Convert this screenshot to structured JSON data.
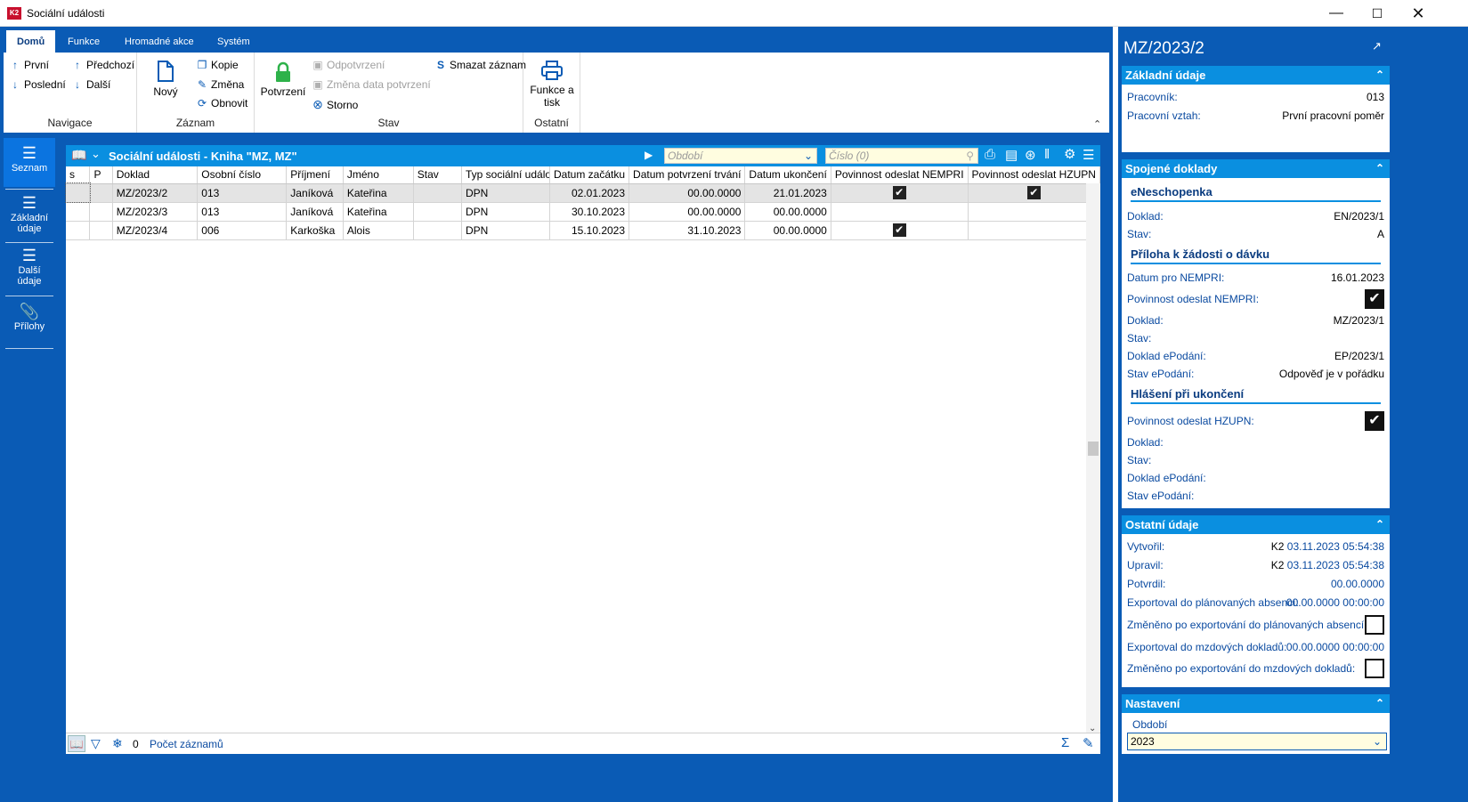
{
  "window": {
    "title": "Sociální události",
    "app_badge": "K2"
  },
  "ribbon": {
    "tabs": [
      "Domů",
      "Funkce",
      "Hromadné akce",
      "Systém"
    ],
    "nav": {
      "first": "První",
      "last": "Poslední",
      "prev": "Předchozí",
      "next": "Další",
      "group": "Navigace"
    },
    "record": {
      "new": "Nový",
      "copy": "Kopie",
      "change": "Změna",
      "refresh": "Obnovit",
      "group": "Záznam"
    },
    "state": {
      "confirm": "Potvrzení",
      "unconfirm": "Odpotvrzení",
      "change_date": "Změna data potvrzení",
      "storno": "Storno",
      "delete": "Smazat záznam",
      "group": "Stav"
    },
    "other": {
      "print_line1": "Funkce a",
      "print_line2": "tisk",
      "group": "Ostatní"
    }
  },
  "sidenav": {
    "items": [
      "Seznam",
      "Základní údaje",
      "Další údaje",
      "Přílohy"
    ]
  },
  "grid": {
    "title": "Sociální události - Kniha \"MZ, MZ\"",
    "period_placeholder": "Období",
    "number_placeholder": "Číslo (0)",
    "columns": [
      "s",
      "P",
      "Doklad",
      "Osobní číslo",
      "Příjmení",
      "Jméno",
      "Stav",
      "Typ sociální události",
      "Datum začátku",
      "Datum potvrzení trvání",
      "Datum ukončení",
      "Povinnost odeslat NEMPRI",
      "Povinnost odeslat HZUPN"
    ],
    "rows": [
      {
        "doklad": "MZ/2023/2",
        "osobni": "013",
        "prijmeni": "Janíková",
        "jmeno": "Kateřina",
        "stav": "",
        "typ": "DPN",
        "zacatek": "02.01.2023",
        "potvrzeni": "00.00.0000",
        "ukonceni": "21.01.2023",
        "nempri": true,
        "hzupn": true
      },
      {
        "doklad": "MZ/2023/3",
        "osobni": "013",
        "prijmeni": "Janíková",
        "jmeno": "Kateřina",
        "stav": "",
        "typ": "DPN",
        "zacatek": "30.10.2023",
        "potvrzeni": "00.00.0000",
        "ukonceni": "00.00.0000",
        "nempri": false,
        "hzupn": false
      },
      {
        "doklad": "MZ/2023/4",
        "osobni": "006",
        "prijmeni": "Karkoška",
        "jmeno": "Alois",
        "stav": "",
        "typ": "DPN",
        "zacatek": "15.10.2023",
        "potvrzeni": "31.10.2023",
        "ukonceni": "00.00.0000",
        "nempri": true,
        "hzupn": false
      }
    ],
    "footer": {
      "count": "0",
      "label": "Počet záznamů"
    }
  },
  "detail": {
    "title": "MZ/2023/2",
    "basic": {
      "head": "Základní údaje",
      "worker_lbl": "Pracovník:",
      "worker": "013",
      "rel_lbl": "Pracovní vztah:",
      "rel": "První pracovní poměr"
    },
    "linked": {
      "head": "Spojené doklady",
      "enesch": {
        "head": "eNeschopenka",
        "doklad_lbl": "Doklad:",
        "doklad": "EN/2023/1",
        "stav_lbl": "Stav:",
        "stav": "A"
      },
      "priloha": {
        "head": "Příloha k žádosti o dávku",
        "datum_lbl": "Datum pro NEMPRI:",
        "datum": "16.01.2023",
        "pov_lbl": "Povinnost odeslat NEMPRI:",
        "doklad_lbl": "Doklad:",
        "doklad": "MZ/2023/1",
        "stav_lbl": "Stav:",
        "stav": "",
        "epod_lbl": "Doklad ePodání:",
        "epod": "EP/2023/1",
        "epodstav_lbl": "Stav ePodání:",
        "epodstav": "Odpověď je v pořádku"
      },
      "hlaseni": {
        "head": "Hlášení při ukončení",
        "pov_lbl": "Povinnost odeslat HZUPN:",
        "doklad_lbl": "Doklad:",
        "stav_lbl": "Stav:",
        "epod_lbl": "Doklad ePodání:",
        "epodstav_lbl": "Stav ePodání:"
      }
    },
    "other": {
      "head": "Ostatní údaje",
      "created_lbl": "Vytvořil:",
      "created_user": "K2",
      "created_date": "03.11.2023 05:54:38",
      "modified_lbl": "Upravil:",
      "modified_user": "K2",
      "modified_date": "03.11.2023 05:54:38",
      "confirmed_lbl": "Potvrdil:",
      "confirmed_date": "00.00.0000",
      "exp_plan_lbl": "Exportoval do plánovaných absencí:",
      "exp_plan": "00.00.0000 00:00:00",
      "chg_plan_lbl": "Změněno po exportování do plánovaných absencí:",
      "exp_mzd_lbl": "Exportoval do mzdových dokladů:",
      "exp_mzd": "00.00.0000 00:00:00",
      "chg_mzd_lbl": "Změněno po exportování do mzdových dokladů:"
    },
    "settings": {
      "head": "Nastavení",
      "period_lbl": "Období",
      "period": "2023"
    }
  },
  "colors": {
    "primary": "#0a5bb5",
    "header": "#0a8fe0",
    "green_lock": "#2eb24a"
  }
}
